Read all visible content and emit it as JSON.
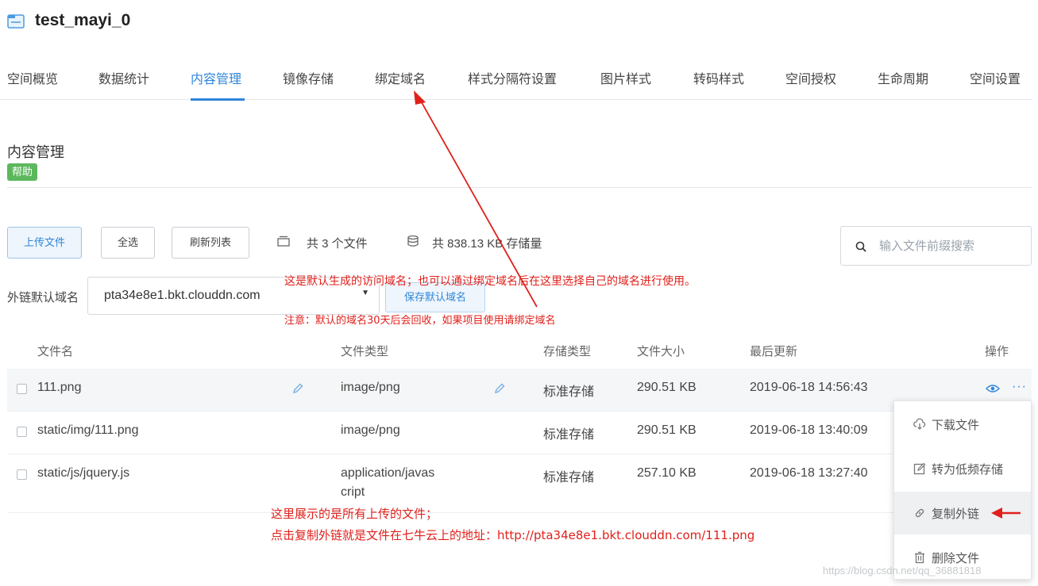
{
  "bucket": {
    "name": "test_mayi_0"
  },
  "tabs": [
    {
      "label": "空间概览"
    },
    {
      "label": "数据统计"
    },
    {
      "label": "内容管理"
    },
    {
      "label": "镜像存储"
    },
    {
      "label": "绑定域名"
    },
    {
      "label": "样式分隔符设置"
    },
    {
      "label": "图片样式"
    },
    {
      "label": "转码样式"
    },
    {
      "label": "空间授权"
    },
    {
      "label": "生命周期"
    },
    {
      "label": "空间设置"
    }
  ],
  "active_tab": "内容管理",
  "section": {
    "title": "内容管理",
    "help": "帮助"
  },
  "toolbar": {
    "upload": "上传文件",
    "select_all": "全选",
    "refresh": "刷新列表",
    "file_count": "共 3 个文件",
    "storage": "共 838.13 KB 存储量"
  },
  "search": {
    "placeholder": "输入文件前缀搜索"
  },
  "domain": {
    "label": "外链默认域名",
    "value": "pta34e8e1.bkt.clouddn.com",
    "save": "保存默认域名"
  },
  "table": {
    "headers": {
      "name": "文件名",
      "type": "文件类型",
      "storage_class": "存储类型",
      "size": "文件大小",
      "updated": "最后更新",
      "ops": "操作"
    },
    "rows": [
      {
        "name": "111.png",
        "type": "image/png",
        "storage_class": "标准存储",
        "size": "290.51 KB",
        "updated": "2019-06-18 14:56:43"
      },
      {
        "name": "static/img/111.png",
        "type": "image/png",
        "storage_class": "标准存储",
        "size": "290.51 KB",
        "updated": "2019-06-18 13:40:09"
      },
      {
        "name": "static/js/jquery.js",
        "type_line1": "application/javas",
        "type_line2": "cript",
        "storage_class": "标准存储",
        "size": "257.10 KB",
        "updated": "2019-06-18 13:27:40"
      }
    ]
  },
  "menu": {
    "download": "下载文件",
    "to_low_freq": "转为低频存储",
    "copy_link": "复制外链",
    "delete": "删除文件"
  },
  "annotations": {
    "domain_note": "这是默认生成的访问域名；也可以通过绑定域名后在这里选择自己的域名进行使用。",
    "domain_warning": "注意：默认的域名30天后会回收，如果项目使用请绑定域名",
    "files_note": "这里展示的是所有上传的文件；",
    "link_note": "点击复制外链就是文件在七牛云上的地址：http://pta34e8e1.bkt.clouddn.com/111.png"
  },
  "watermark": "https://blog.csdn.net/qq_36881818",
  "colors": {
    "accent": "#2f86d9",
    "help_green": "#5cb85c",
    "annotation_red": "#e0201b"
  }
}
